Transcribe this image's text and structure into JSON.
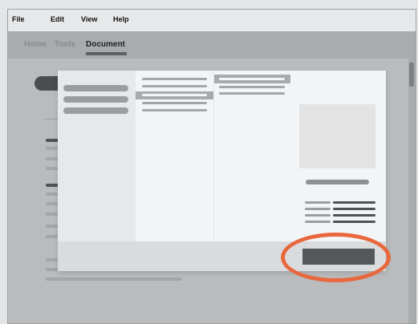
{
  "menu": {
    "items": [
      "File",
      "Edit",
      "View",
      "Help"
    ]
  },
  "tabs": {
    "items": [
      "Home",
      "Tools",
      "Document"
    ],
    "active_index": 2
  },
  "dialog": {
    "type": "file-picker",
    "preview_image": "placeholder-image"
  },
  "annotation": {
    "color": "#e8673d",
    "target": "confirm-button"
  },
  "colors": {
    "accent": "#e8673d",
    "button": "#555859",
    "dialog": "#f2f5f7"
  }
}
